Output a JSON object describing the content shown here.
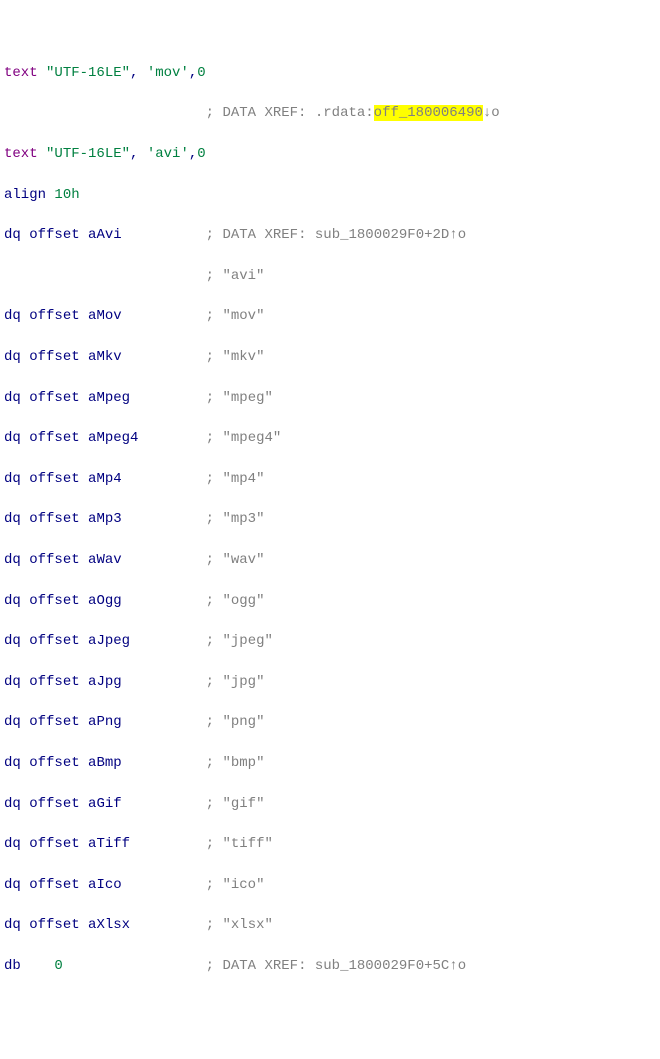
{
  "line1": {
    "kw": "text",
    "s1": "\"UTF-16LE\"",
    "m": ", ",
    "s2": "'mov'",
    "m2": ",",
    "n": "0"
  },
  "line2": {
    "pad": "                        ",
    "c1": "; DATA XREF: ",
    "sec": ".rdata:",
    "link": "off_180006490",
    "arr": "↓",
    "tail": "o"
  },
  "line3": {
    "kw": "text",
    "s1": "\"UTF-16LE\"",
    "m": ", ",
    "s2": "'avi'",
    "m2": ",",
    "n": "0"
  },
  "line4": {
    "kw": "align",
    "sp": " ",
    "n": "10h"
  },
  "dq": [
    {
      "size": "dq",
      "off": "offset",
      "name": "aAvi",
      "pad": "dq offset aAvi          ",
      "c": "; DATA XREF: sub_1800029F0+2D↑o"
    },
    {
      "size": "dq",
      "off": "offset",
      "name": "aAvi",
      "pad": "                        ",
      "c": "; \"avi\""
    },
    {
      "size": "dq",
      "off": "offset",
      "name": "aMov",
      "pad": "dq offset aMov          ",
      "c": "; \"mov\""
    },
    {
      "size": "dq",
      "off": "offset",
      "name": "aMkv",
      "pad": "dq offset aMkv          ",
      "c": "; \"mkv\""
    },
    {
      "size": "dq",
      "off": "offset",
      "name": "aMpeg",
      "pad": "dq offset aMpeg         ",
      "c": "; \"mpeg\""
    },
    {
      "size": "dq",
      "off": "offset",
      "name": "aMpeg4",
      "pad": "dq offset aMpeg4        ",
      "c": "; \"mpeg4\""
    },
    {
      "size": "dq",
      "off": "offset",
      "name": "aMp4",
      "pad": "dq offset aMp4          ",
      "c": "; \"mp4\""
    },
    {
      "size": "dq",
      "off": "offset",
      "name": "aMp3",
      "pad": "dq offset aMp3          ",
      "c": "; \"mp3\""
    },
    {
      "size": "dq",
      "off": "offset",
      "name": "aWav",
      "pad": "dq offset aWav          ",
      "c": "; \"wav\""
    },
    {
      "size": "dq",
      "off": "offset",
      "name": "aOgg",
      "pad": "dq offset aOgg          ",
      "c": "; \"ogg\""
    },
    {
      "size": "dq",
      "off": "offset",
      "name": "aJpeg",
      "pad": "dq offset aJpeg         ",
      "c": "; \"jpeg\""
    },
    {
      "size": "dq",
      "off": "offset",
      "name": "aJpg",
      "pad": "dq offset aJpg          ",
      "c": "; \"jpg\""
    },
    {
      "size": "dq",
      "off": "offset",
      "name": "aPng",
      "pad": "dq offset aPng          ",
      "c": "; \"png\""
    },
    {
      "size": "dq",
      "off": "offset",
      "name": "aBmp",
      "pad": "dq offset aBmp          ",
      "c": "; \"bmp\""
    },
    {
      "size": "dq",
      "off": "offset",
      "name": "aGif",
      "pad": "dq offset aGif          ",
      "c": "; \"gif\""
    },
    {
      "size": "dq",
      "off": "offset",
      "name": "aTiff",
      "pad": "dq offset aTiff         ",
      "c": "; \"tiff\""
    },
    {
      "size": "dq",
      "off": "offset",
      "name": "aIco",
      "pad": "dq offset aIco          ",
      "c": "; \"ico\""
    },
    {
      "size": "dq",
      "off": "offset",
      "name": "aXlsx",
      "pad": "dq offset aXlsx         ",
      "c": "; \"xlsx\""
    }
  ],
  "lastline": {
    "db": "db",
    "pad": "    ",
    "zero": "0",
    "pad2": "                 ",
    "c": "; DATA XREF: sub_1800029F0+5C↑o"
  }
}
